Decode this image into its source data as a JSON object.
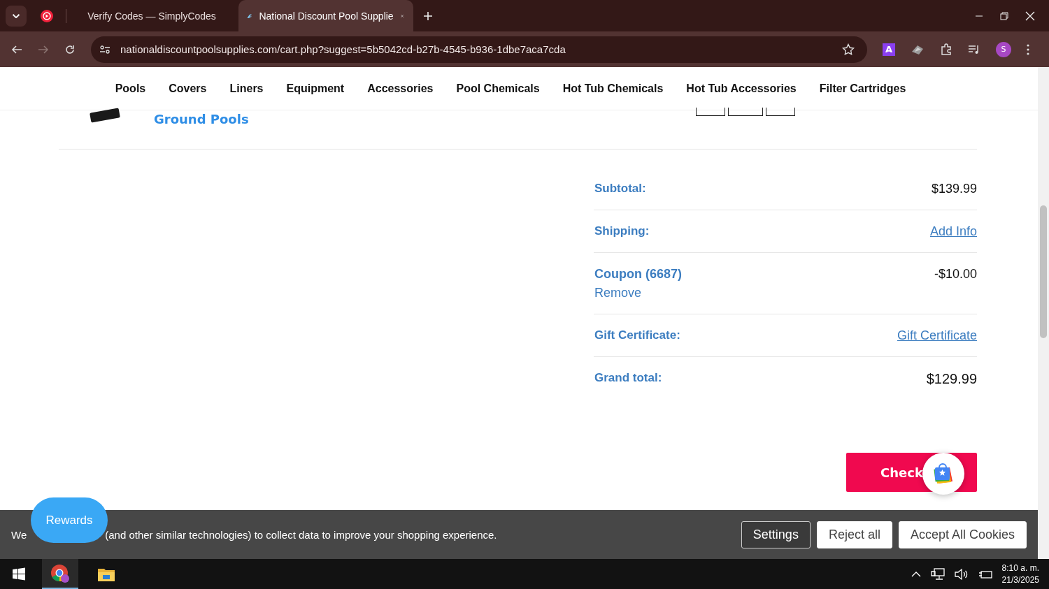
{
  "browser": {
    "tabs": [
      {
        "title": "Verify Codes — SimplyCodes",
        "selected": false,
        "kind": "simplycodes"
      },
      {
        "title": "National Discount Pool Supplie",
        "selected": true,
        "kind": "pool"
      }
    ],
    "url": "nationaldiscountpoolsupplies.com/cart.php?suggest=5b5042cd-b27b-4545-b936-1dbe7aca7cda",
    "extension_badge": "A",
    "profile_initial": "S"
  },
  "nav": [
    "Pools",
    "Covers",
    "Liners",
    "Equipment",
    "Accessories",
    "Pool Chemicals",
    "Hot Tub Chemicals",
    "Hot Tub Accessories",
    "Filter Cartridges"
  ],
  "cart_item": {
    "name": "Ground Pools"
  },
  "summary": [
    {
      "label": "Subtotal:",
      "kind": "value",
      "value": "$139.99"
    },
    {
      "label": "Shipping:",
      "kind": "link",
      "value": "Add Info"
    },
    {
      "label": "Coupon (6687)",
      "kind": "coupon",
      "value": "-$10.00",
      "action": "Remove"
    },
    {
      "label": "Gift Certificate:",
      "kind": "link",
      "value": "Gift Certificate"
    },
    {
      "label": "Grand total:",
      "kind": "total",
      "value": "$129.99"
    }
  ],
  "checkout_button": "Check",
  "rewards_button": "Rewards",
  "cookie_banner": {
    "text_start": "We",
    "text_rest": "(and other similar technologies) to collect data to improve your shopping experience.",
    "buttons": [
      {
        "label": "Settings",
        "kind": "outline"
      },
      {
        "label": "Reject all",
        "kind": "solid"
      },
      {
        "label": "Accept All Cookies",
        "kind": "solid"
      }
    ]
  },
  "taskbar": {
    "time": "8:10 a. m.",
    "date": "21/3/2025"
  }
}
